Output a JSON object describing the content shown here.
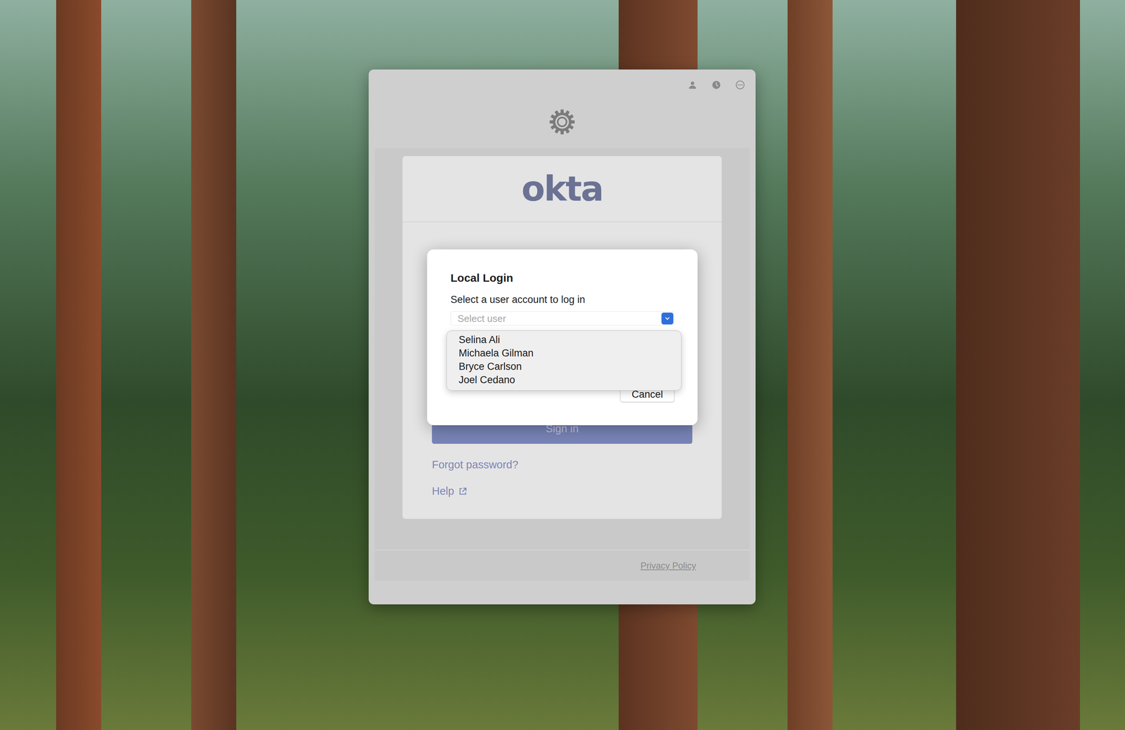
{
  "brand": {
    "logo": "okta"
  },
  "sign_in": {
    "button": "Sign in",
    "links": [
      {
        "label": "Forgot password?",
        "external": false
      },
      {
        "label": "Help",
        "external": true
      }
    ]
  },
  "footer": {
    "link": "Privacy Policy"
  },
  "dialog": {
    "title": "Local Login",
    "prompt": "Select a user account to log in",
    "select": {
      "placeholder": "Select user",
      "expanded": true,
      "options": [
        {
          "label": "Selina Ali",
          "selected": false
        },
        {
          "label": "Michaela Gilman",
          "selected": false
        },
        {
          "label": "Bryce Carlson",
          "selected": false
        },
        {
          "label": "Joel Cedano",
          "selected": false
        }
      ]
    },
    "buttons": [
      "Cancel"
    ]
  }
}
